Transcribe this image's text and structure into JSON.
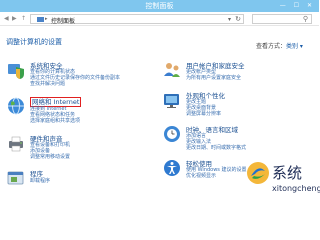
{
  "window": {
    "title": "控制面板",
    "controls": "— ☐ ✕"
  },
  "address": {
    "path": "控制面板",
    "separator": "▸",
    "refresh": "↻",
    "back": "◀",
    "forward": "▶",
    "up": "↑"
  },
  "search": {
    "icon": "search-icon"
  },
  "heading": "调整计算机的设置",
  "view_by": {
    "label": "查看方式：",
    "value": "类别 ▾"
  },
  "left_categories": [
    {
      "title": "系统和安全",
      "links": [
        "查看你的计算机状态",
        "通过文件历史记录保存你的文件备份副本",
        "查找并解决问题"
      ],
      "icon": "shield-icon"
    },
    {
      "title": "网络和 Internet",
      "links": [
        "连接到 Internet",
        "查看网络状态和任务",
        "选择家庭组和共享选项"
      ],
      "icon": "network-globe-icon"
    },
    {
      "title": "硬件和声音",
      "links": [
        "查看设备和打印机",
        "添加设备",
        "调整常用移动设置"
      ],
      "icon": "printer-icon"
    },
    {
      "title": "程序",
      "links": [
        "卸载程序"
      ],
      "icon": "programs-icon"
    }
  ],
  "right_categories": [
    {
      "title": "用户帐户和家庭安全",
      "links": [
        "更改帐户类型",
        "为所有用户设置家庭安全"
      ],
      "icon": "users-icon"
    },
    {
      "title": "外观和个性化",
      "links": [
        "更改主题",
        "更改桌面背景",
        "调整屏幕分辨率"
      ],
      "icon": "appearance-icon"
    },
    {
      "title": "时钟、语言和区域",
      "links": [
        "添加语言",
        "更改输入法",
        "更改日期、时间或数字格式"
      ],
      "icon": "clock-globe-icon"
    },
    {
      "title": "轻松使用",
      "links": [
        "使用 Windows 建议的设置",
        "优化视频显示"
      ],
      "icon": "ease-of-access-icon"
    }
  ],
  "watermark": {
    "brand": "系统",
    "url": "xitongcheng",
    "icon": "watermark-logo-icon"
  },
  "colors": {
    "titlebar": "#7fc6ee",
    "link": "#1a4f91",
    "highlight": "#e02020"
  }
}
